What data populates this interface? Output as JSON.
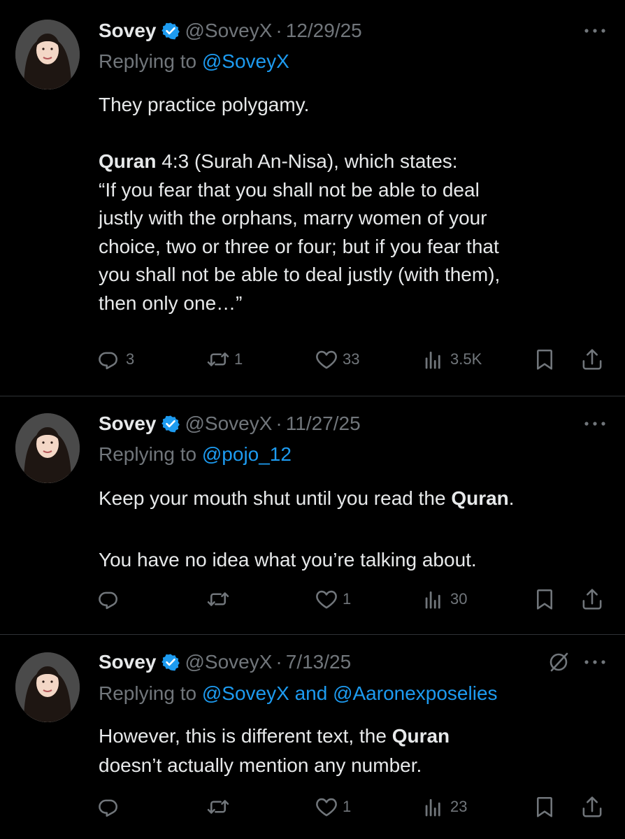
{
  "tweets": [
    {
      "name": "Sovey",
      "handle": "@SoveyX",
      "date": "12/29/25",
      "replying_label": "Replying to ",
      "replying_to": "@SoveyX",
      "line1": "They practice polygamy.",
      "ref_bold": "Quran",
      "ref_rest": " 4:3 (Surah An-Nisa), which states:",
      "quote_lines": [
        "“If you fear that you shall not be able to deal",
        "justly with the orphans, marry women of your",
        "choice, two or three or four; but if you fear that",
        "you shall not be able to deal justly (with them),",
        "then only one…”"
      ],
      "stats": {
        "replies": "3",
        "reposts": "1",
        "likes": "33",
        "views": "3.5K"
      }
    },
    {
      "name": "Sovey",
      "handle": "@SoveyX",
      "date": "11/27/25",
      "replying_label": "Replying to ",
      "replying_to": "@pojo_12",
      "line1_pre": "Keep your mouth shut until you read the ",
      "line1_bold": "Quran",
      "line1_post": ".",
      "line2": "You have no idea what you’re talking about.",
      "stats": {
        "likes": "1",
        "views": "30"
      }
    },
    {
      "name": "Sovey",
      "handle": "@SoveyX",
      "date": "7/13/25",
      "replying_label": "Replying to ",
      "replying_to": "@SoveyX and @Aaronexposelies",
      "line1_pre": "However, this is different text, the ",
      "line1_bold": "Quran",
      "line2": "doesn’t actually mention any number.",
      "stats": {
        "likes": "1",
        "views": "23"
      }
    }
  ],
  "separator": "·",
  "colors": {
    "background": "#000000",
    "text": "#e7e9ea",
    "secondary": "#71767b",
    "link": "#1d9bf0",
    "verified": "#1d9bf0",
    "divider": "#2f3336"
  },
  "icons": [
    "verified-badge-icon",
    "more-icon",
    "grok-icon",
    "reply-icon",
    "repost-icon",
    "like-icon",
    "views-icon",
    "bookmark-icon",
    "share-icon"
  ]
}
